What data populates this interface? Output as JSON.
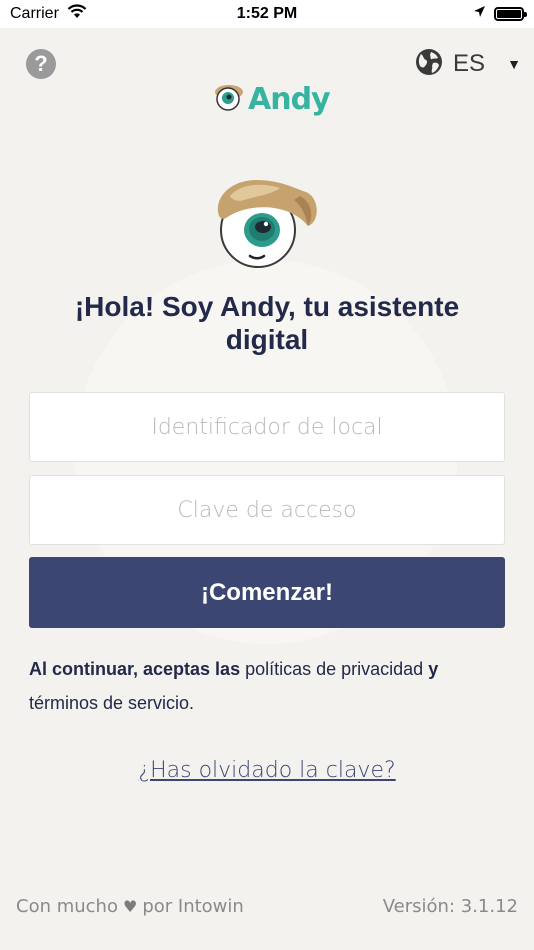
{
  "status_bar": {
    "carrier": "Carrier",
    "time": "1:52 PM"
  },
  "header": {
    "help_symbol": "?",
    "language_code": "ES",
    "logo_text": "Andy",
    "globe_icon": "globe-icon",
    "chevron_icon": "chevron-down-icon"
  },
  "main": {
    "headline": "¡Hola! Soy Andy, tu asistente digital",
    "local_id_placeholder": "Identificador de local",
    "access_key_placeholder": "Clave de acceso",
    "start_label": "¡Comenzar!",
    "terms": {
      "part1": "Al continuar, aceptas las",
      "privacy_link": "políticas de privacidad",
      "part2": "y",
      "terms_link": "términos de servicio."
    },
    "forgot_link": "¿Has olvidado la clave?"
  },
  "footer": {
    "made_with": "Con mucho",
    "by": "por Intowin",
    "version": "Versión: 3.1.12"
  },
  "colors": {
    "background": "#f3f2ee",
    "primary": "#3b4673",
    "brand_teal": "#36b3a1",
    "headline": "#23294a"
  }
}
